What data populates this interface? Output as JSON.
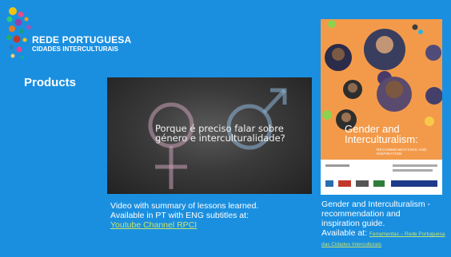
{
  "logo": {
    "line1": "REDE PORTUGUESA",
    "line2": "CIDADES INTERCULTURAIS"
  },
  "title": "Products",
  "video": {
    "overlay_text": "Porque é preciso falar sobre género e interculturalidade?"
  },
  "left_caption": {
    "line1": "Video with summary of lessons learned.",
    "line2": "Available in PT with ENG subtitles at:",
    "link": "Youtube Channel RPCI"
  },
  "cover": {
    "title": "Gender and Interculturalism:",
    "subtitle": "RECOMMENDATIONS AND INSPIRATION"
  },
  "right_caption": {
    "line1": "Gender and Interculturalism -",
    "line2": "recommendation and",
    "line3": "inspiration guide.",
    "available": "Available at:",
    "link": "Ferramentas – Rede Portuguesa das Cidades Interculturais"
  },
  "colors": {
    "background": "#1a8fe0",
    "link": "#c8e36a",
    "cover": "#f39a4a"
  }
}
